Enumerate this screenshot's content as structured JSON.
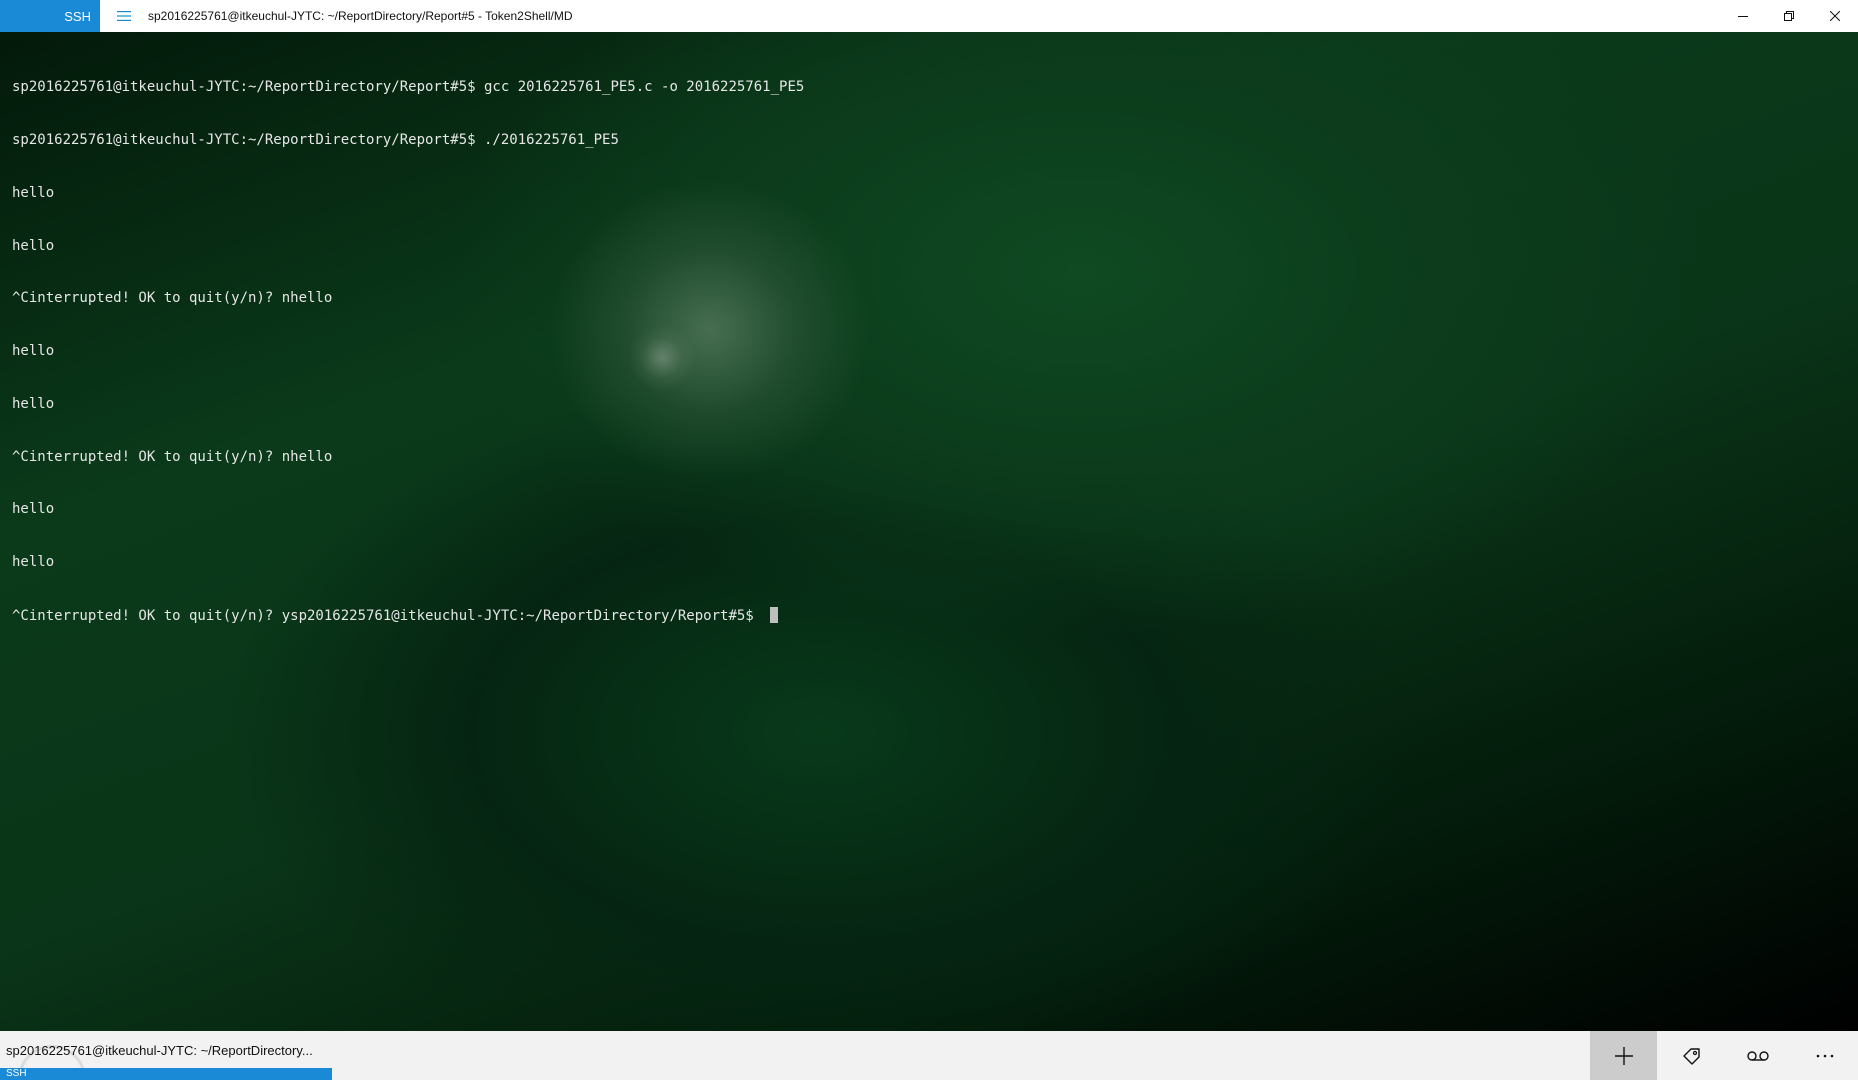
{
  "titlebar": {
    "tab_label": "SSH",
    "title": "sp2016225761@itkeuchul-JYTC: ~/ReportDirectory/Report#5 - Token2Shell/MD"
  },
  "terminal": {
    "lines": [
      "sp2016225761@itkeuchul-JYTC:~/ReportDirectory/Report#5$ gcc 2016225761_PE5.c -o 2016225761_PE5",
      "sp2016225761@itkeuchul-JYTC:~/ReportDirectory/Report#5$ ./2016225761_PE5",
      "hello",
      "hello",
      "^Cinterrupted! OK to quit(y/n)? nhello",
      "hello",
      "hello",
      "^Cinterrupted! OK to quit(y/n)? nhello",
      "hello",
      "hello",
      "^Cinterrupted! OK to quit(y/n)? ysp2016225761@itkeuchul-JYTC:~/ReportDirectory/Report#5$ "
    ]
  },
  "bottombar": {
    "session_title": "sp2016225761@itkeuchul-JYTC: ~/ReportDirectory...",
    "session_label": "SSH"
  },
  "icons": {
    "menu": "hamburger-menu-icon",
    "minimize": "minimize-icon",
    "restore": "restore-icon",
    "close": "close-icon",
    "add": "plus-icon",
    "tag": "tag-icon",
    "record": "voicemail-icon",
    "more": "more-icon"
  },
  "colors": {
    "accent": "#1b8ad6",
    "terminal_text": "#e6e6e6",
    "cursor": "#bfbfbf"
  }
}
